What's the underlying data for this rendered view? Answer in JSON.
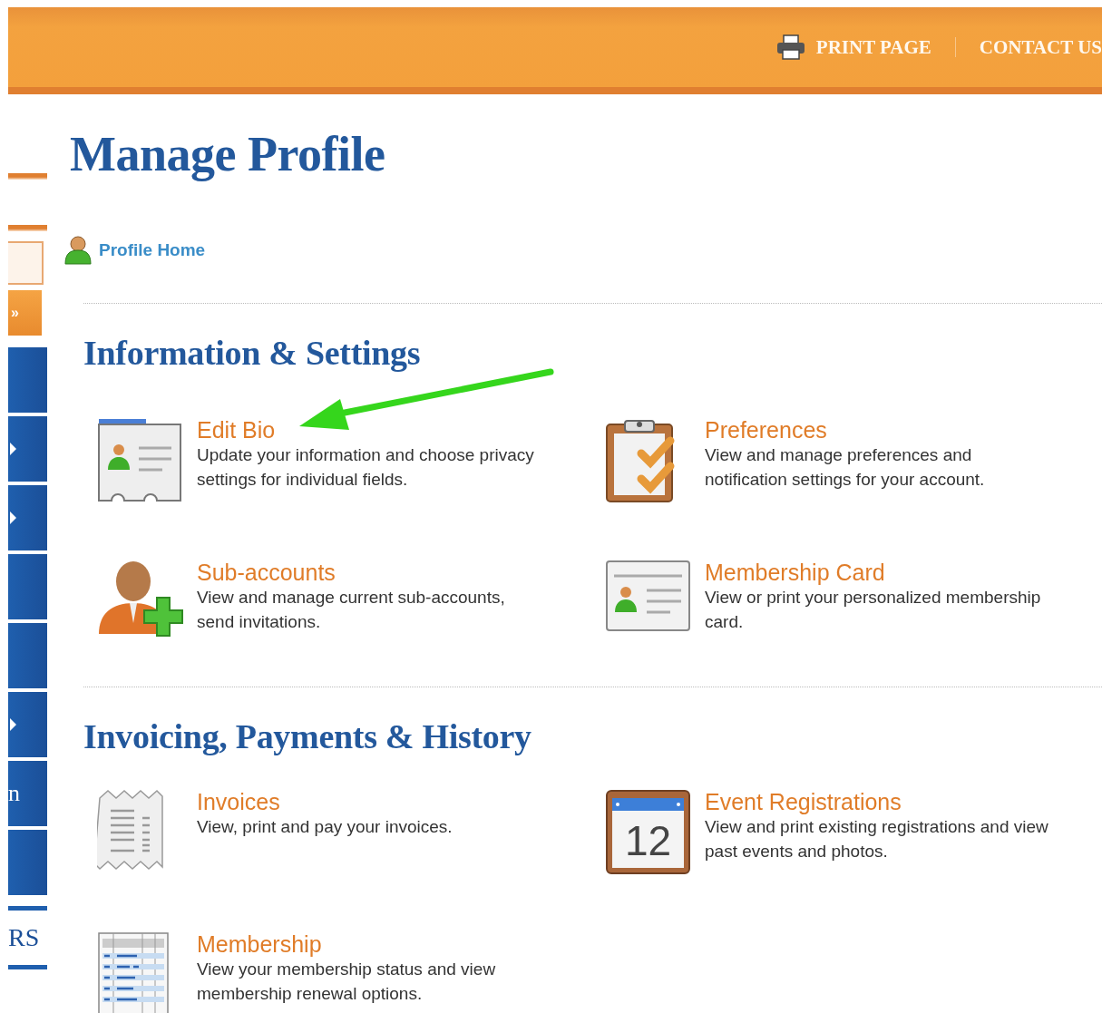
{
  "header": {
    "links": [
      {
        "label": "PRINT PAGE",
        "kind": "print"
      },
      {
        "label": "CONTACT US",
        "kind": "plain"
      }
    ]
  },
  "sidebar": {
    "items": [
      {
        "kind": "rule"
      },
      {
        "kind": "rule"
      },
      {
        "kind": "box"
      },
      {
        "kind": "button",
        "text": "»"
      },
      {
        "kind": "block",
        "arrow": false
      },
      {
        "kind": "block",
        "arrow": true
      },
      {
        "kind": "block",
        "arrow": true
      },
      {
        "kind": "block",
        "arrow": false
      },
      {
        "kind": "block",
        "arrow": false
      },
      {
        "kind": "block",
        "arrow": true
      },
      {
        "kind": "block",
        "arrow": false,
        "text": "n"
      },
      {
        "kind": "block",
        "arrow": false
      },
      {
        "kind": "label",
        "text": "RS"
      }
    ]
  },
  "page": {
    "title": "Manage Profile",
    "home_link": "Profile Home",
    "sections": [
      {
        "heading": "Information & Settings",
        "items": [
          {
            "kind": "bio-card",
            "title": "Edit Bio",
            "description": "Update your information and choose privacy settings for individual fields."
          },
          {
            "kind": "clipboard",
            "title": "Preferences",
            "description": "View and manage preferences and notification settings for your account."
          },
          {
            "kind": "person-add",
            "title": "Sub-accounts",
            "description": "View and manage current sub-accounts, send invitations."
          },
          {
            "kind": "id-card",
            "title": "Membership Card",
            "description": "View or print your personalized membership card."
          }
        ]
      },
      {
        "heading": "Invoicing, Payments & History",
        "items": [
          {
            "kind": "receipt",
            "title": "Invoices",
            "description": "View, print and pay your invoices."
          },
          {
            "kind": "calendar",
            "calendar_day": "12",
            "title": "Event Registrations",
            "description": "View and print existing registrations and view past events and photos."
          },
          {
            "kind": "table",
            "title": "Membership",
            "description": "View your membership status and view membership renewal options."
          }
        ]
      }
    ]
  },
  "annotation": {
    "kind": "arrow"
  }
}
